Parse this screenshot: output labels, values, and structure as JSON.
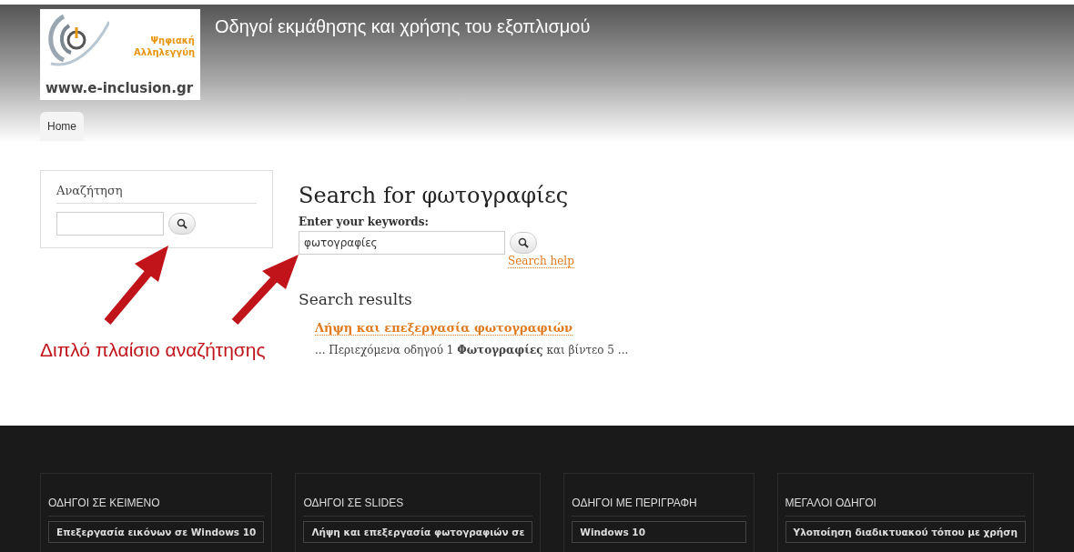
{
  "header": {
    "logo": {
      "line_1": "Ψηφιακή",
      "line_2": "Αλληλεγγύη",
      "url": "www.e-inclusion.gr"
    },
    "site_title": "Οδηγοί εκμάθησης και χρήσης του εξοπλισμού"
  },
  "tabs": [
    {
      "label": "Home",
      "selected": true
    }
  ],
  "sidebar_search": {
    "title": "Αναζήτηση"
  },
  "annotation": {
    "text": "Διπλό πλαίσιο αναζήτησης"
  },
  "search": {
    "heading": "Search for φωτογραφίες",
    "label": "Enter your keywords:",
    "value": "φωτογραφίες",
    "help_link": "Search help"
  },
  "results": {
    "heading": "Search results",
    "items": [
      {
        "title": "Λήψη και επεξεργασία φωτογραφιών",
        "snippet": "... Περιεχόμενα οδηγού 1 **Φωτογραφίες** και βίντεο 5 ..."
      }
    ]
  },
  "footer": {
    "columns": [
      {
        "title": "ΟΔΗΓΟΙ ΣΕ ΚΕΙΜΕΝΟ",
        "links": [
          "Επεξεργασία εικόνων σε Windows 10"
        ]
      },
      {
        "title": "ΟΔΗΓΟΙ ΣΕ SLIDES",
        "links": [
          "Λήψη και επεξεργασία φωτογραφιών σε"
        ]
      },
      {
        "title": "ΟΔΗΓΟΙ ΜΕ ΠΕΡΙΓΡΑΦΗ",
        "links": [
          "Windows 10"
        ]
      },
      {
        "title": "ΜΕΓΑΛΟΙ ΟΔΗΓΟΙ",
        "links": [
          "Υλοποίηση διαδικτυακού τόπου με χρήση"
        ]
      }
    ]
  }
}
